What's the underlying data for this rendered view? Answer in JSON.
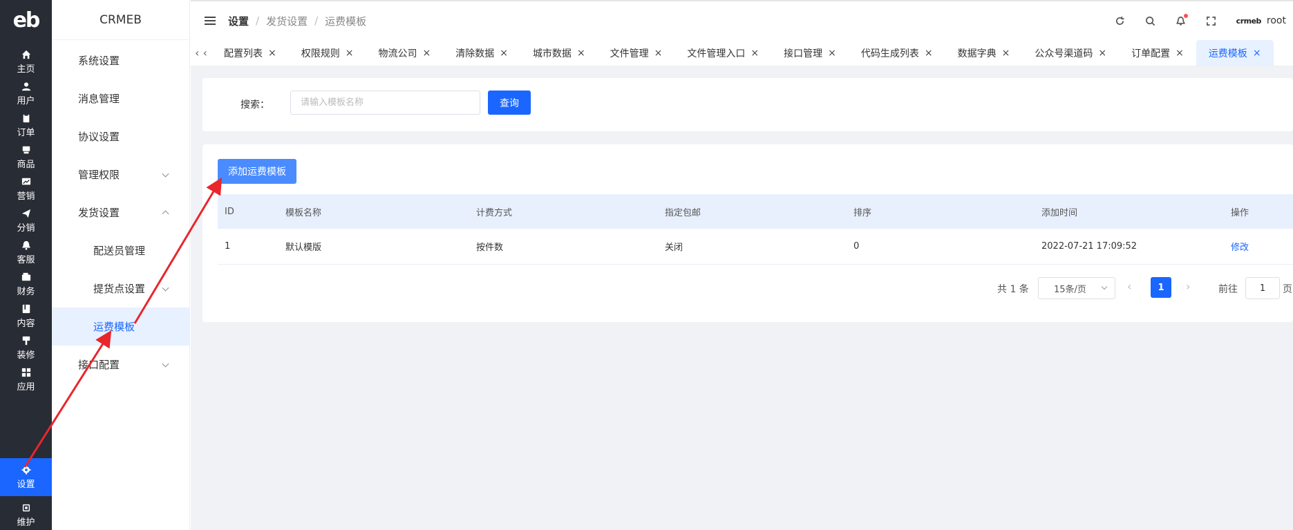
{
  "rail": {
    "logo": "eb",
    "items": [
      {
        "label": "主页",
        "icon": "home-icon"
      },
      {
        "label": "用户",
        "icon": "user-icon"
      },
      {
        "label": "订单",
        "icon": "order-icon"
      },
      {
        "label": "商品",
        "icon": "goods-icon"
      },
      {
        "label": "营销",
        "icon": "marketing-icon"
      },
      {
        "label": "分销",
        "icon": "send-icon"
      },
      {
        "label": "客服",
        "icon": "bell-icon"
      },
      {
        "label": "财务",
        "icon": "wallet-icon"
      },
      {
        "label": "内容",
        "icon": "book-icon"
      },
      {
        "label": "装修",
        "icon": "brush-icon"
      },
      {
        "label": "应用",
        "icon": "grid-icon"
      },
      {
        "label": "设置",
        "icon": "gear-icon"
      },
      {
        "label": "维护",
        "icon": "chip-icon"
      }
    ],
    "active_color": "#1a66ff"
  },
  "submenu": {
    "title": "CRMEB",
    "items": [
      {
        "label": "系统设置"
      },
      {
        "label": "消息管理"
      },
      {
        "label": "协议设置"
      },
      {
        "label": "管理权限"
      },
      {
        "label": "发货设置"
      },
      {
        "label": "配送员管理"
      },
      {
        "label": "提货点设置"
      },
      {
        "label": "运费模板"
      },
      {
        "label": "接口配置"
      }
    ]
  },
  "header": {
    "breadcrumb": [
      "设置",
      "发货设置",
      "运费模板"
    ],
    "brand": "crmeb",
    "username": "root"
  },
  "tabs": [
    "配置列表",
    "权限规则",
    "物流公司",
    "清除数据",
    "城市数据",
    "文件管理",
    "文件管理入口",
    "接口管理",
    "代码生成列表",
    "数据字典",
    "公众号渠道码",
    "订单配置",
    "运费模板"
  ],
  "search": {
    "label": "搜索：",
    "placeholder": "请输入模板名称",
    "button": "查询"
  },
  "table": {
    "add_button": "添加运费模板",
    "columns": [
      "ID",
      "模板名称",
      "计费方式",
      "指定包邮",
      "排序",
      "添加时间",
      "操作"
    ],
    "rows": [
      {
        "id": "1",
        "name": "默认模版",
        "billing": "按件数",
        "free_shipping": "关闭",
        "sort": "0",
        "created": "2022-07-21 17:09:52",
        "action": "修改"
      }
    ]
  },
  "pagination": {
    "total": "共 1 条",
    "page_size": "15条/页",
    "current_page": "1",
    "goto_label": "前往",
    "goto_value": "1",
    "page_suffix": "页"
  },
  "colors": {
    "primary": "#1a66ff",
    "rail_bg": "#282c34",
    "annotation": "#e8262c"
  }
}
